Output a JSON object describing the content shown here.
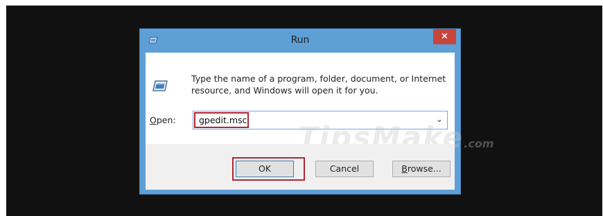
{
  "window": {
    "title": "Run",
    "close_label": "×"
  },
  "content": {
    "description": "Type the name of a program, folder, document, or Internet resource, and Windows will open it for you.",
    "open_label_accel": "O",
    "open_label_rest": "pen:",
    "open_value": "gpedit.msc",
    "dropdown_arrow": "⌄"
  },
  "buttons": {
    "ok": "OK",
    "cancel": "Cancel",
    "browse_accel": "B",
    "browse_rest": "rowse..."
  },
  "watermark": {
    "text": "TipsMake",
    "suffix": ".com"
  },
  "colors": {
    "backdrop": "#111111",
    "frame": "#5e9fd6",
    "close": "#c8453b",
    "highlight": "#b02534"
  },
  "icons": {
    "title": "run-app-icon",
    "body": "run-app-icon",
    "close": "close-icon",
    "dropdown": "chevron-down-icon"
  }
}
